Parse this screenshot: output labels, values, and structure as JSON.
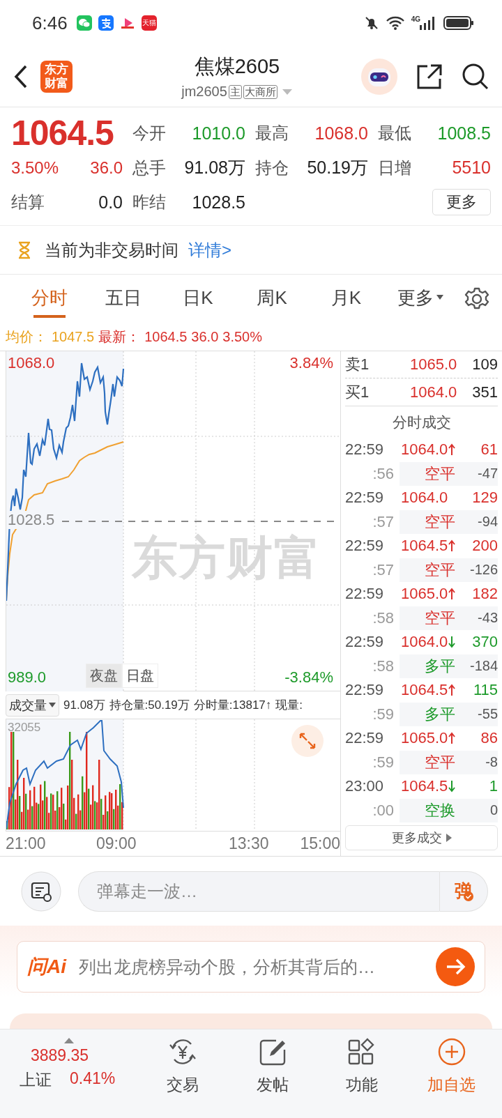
{
  "status_bar": {
    "time": "6:46",
    "apps": [
      {
        "kind": "chat"
      },
      {
        "kind": "pay"
      },
      {
        "kind": "video"
      },
      {
        "kind": "shop",
        "label": "天猫"
      }
    ],
    "network": "4G"
  },
  "header": {
    "logo": "东方财富",
    "title": "焦煤2605",
    "code": "jm2605",
    "tags": [
      "主",
      "大商所"
    ]
  },
  "quote": {
    "price": "1064.5",
    "change_pct": "3.50%",
    "change": "36.0",
    "color": "#d9302c",
    "settle": {
      "label": "结算",
      "value": "0.0"
    },
    "rows": [
      [
        {
          "label": "今开",
          "value": "1010.0",
          "color": "#1d9a2a"
        },
        {
          "label": "最高",
          "value": "1068.0",
          "color": "#d9302c"
        },
        {
          "label": "最低",
          "value": "1008.5",
          "color": "#1d9a2a"
        }
      ],
      [
        {
          "label": "总手",
          "value": "91.08万",
          "color": "#222222"
        },
        {
          "label": "持仓",
          "value": "50.19万",
          "color": "#222222"
        },
        {
          "label": "日增",
          "value": "5510",
          "color": "#d9302c"
        }
      ],
      [
        {
          "label": "昨结",
          "value": "1028.5",
          "color": "#222222"
        }
      ]
    ],
    "more_button": "更多"
  },
  "notice": {
    "text": "当前为非交易时间",
    "link": "详情>"
  },
  "tabs": [
    {
      "label": "分时",
      "selected": true
    },
    {
      "label": "五日",
      "selected": false
    },
    {
      "label": "日K",
      "selected": false
    },
    {
      "label": "周K",
      "selected": false
    },
    {
      "label": "月K",
      "selected": false
    },
    {
      "label": "更多",
      "selected": false,
      "has_menu": true
    }
  ],
  "summary": {
    "avg_label": "均价：",
    "avg": "1047.5",
    "latest_label": "最新：",
    "latest": "1064.5",
    "change": "36.0",
    "change_pct": "3.50%"
  },
  "chart": {
    "max": "1068.0",
    "max_pct": "3.84%",
    "prev_settle": "1028.5",
    "min": "989.0",
    "min_pct": "-3.84%",
    "watermark": "东方财富",
    "sessions": [
      {
        "label": "夜盘",
        "selected": true
      },
      {
        "label": "日盘",
        "selected": false
      }
    ]
  },
  "volume_bar": {
    "selector": "成交量",
    "total": "91.08万",
    "open_interest": "持仓量:50.19万",
    "tick_volume": "分时量:13817↑",
    "current": "现量:"
  },
  "volume_chart": {
    "max": "32055"
  },
  "time_axis": [
    "21:00",
    "09:00",
    "13:30",
    "15:00"
  ],
  "order_book": [
    {
      "label": "卖1",
      "price": "1065.0",
      "volume": "109"
    },
    {
      "label": "买1",
      "price": "1064.0",
      "volume": "351"
    }
  ],
  "trades_title": "分时成交",
  "trades": [
    {
      "time": "22:59",
      "sub": ":56",
      "price": "1064.0",
      "tick_up": true,
      "tick_down": false,
      "volume": "61",
      "color": "#d9302c",
      "action": {
        "label": "空平",
        "color": "#d9302c"
      },
      "delta": "-47"
    },
    {
      "time": "22:59",
      "sub": ":57",
      "price": "1064.0",
      "tick_up": false,
      "tick_down": false,
      "volume": "129",
      "color": "#d9302c",
      "action": {
        "label": "空平",
        "color": "#d9302c"
      },
      "delta": "-94"
    },
    {
      "time": "22:59",
      "sub": ":57",
      "price": "1064.5",
      "tick_up": true,
      "tick_down": false,
      "volume": "200",
      "color": "#d9302c",
      "action": {
        "label": "空平",
        "color": "#d9302c"
      },
      "delta": "-126"
    },
    {
      "time": "22:59",
      "sub": ":58",
      "price": "1065.0",
      "tick_up": true,
      "tick_down": false,
      "volume": "182",
      "color": "#d9302c",
      "action": {
        "label": "空平",
        "color": "#d9302c"
      },
      "delta": "-43"
    },
    {
      "time": "22:59",
      "sub": ":58",
      "price": "1064.0",
      "tick_up": false,
      "tick_down": true,
      "volume": "370",
      "color": "#1d9a2a",
      "action": {
        "label": "多平",
        "color": "#1d9a2a"
      },
      "delta": "-184"
    },
    {
      "time": "22:59",
      "sub": ":59",
      "price": "1064.5",
      "tick_up": true,
      "tick_down": false,
      "volume": "115",
      "color": "#1d9a2a",
      "action": {
        "label": "多平",
        "color": "#1d9a2a"
      },
      "delta": "-55"
    },
    {
      "time": "22:59",
      "sub": ":59",
      "price": "1065.0",
      "tick_up": true,
      "tick_down": false,
      "volume": "86",
      "color": "#d9302c",
      "action": {
        "label": "空平",
        "color": "#d9302c"
      },
      "delta": "-8"
    },
    {
      "time": "23:00",
      "sub": ":00",
      "price": "1064.5",
      "tick_up": false,
      "tick_down": true,
      "volume": "1",
      "color": "#1d9a2a",
      "action": {
        "label": "空换",
        "color": "#1d9a2a"
      },
      "delta": "0"
    }
  ],
  "more_trades": "更多成交",
  "comment": {
    "placeholder": "弹幕走一波…",
    "send": "弹"
  },
  "ai": {
    "logo": "问Ai",
    "prompt": "列出龙虎榜异动个股，分析其背后的…"
  },
  "bottom_nav": {
    "index": {
      "value": "3889.35",
      "name": "上证",
      "change": "0.41%",
      "color": "#d9302c"
    },
    "items": [
      {
        "kind": "trade",
        "label": "交易",
        "highlighted": false
      },
      {
        "kind": "post",
        "label": "发帖",
        "highlighted": false
      },
      {
        "kind": "apps",
        "label": "功能",
        "highlighted": false
      },
      {
        "kind": "add",
        "label": "加自选",
        "highlighted": true
      }
    ]
  }
}
